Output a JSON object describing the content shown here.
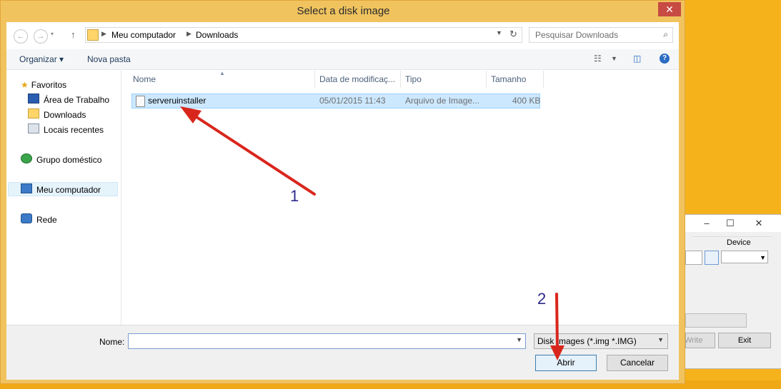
{
  "dialog": {
    "title": "Select a disk image",
    "close_label": "✕"
  },
  "address": {
    "back_glyph": "←",
    "forward_glyph": "→",
    "up_glyph": "↑",
    "crumbs": [
      "Meu computador",
      "Downloads"
    ],
    "search_placeholder": "Pesquisar Downloads"
  },
  "toolbar": {
    "organize_label": "Organizar ▾",
    "new_folder_label": "Nova pasta",
    "help_label": "?"
  },
  "nav": {
    "items": [
      {
        "label": "Favoritos",
        "icon": "star-icon"
      },
      {
        "label": "Área de Trabalho",
        "icon": "desktop-icon"
      },
      {
        "label": "Downloads",
        "icon": "folder-icon"
      },
      {
        "label": "Locais recentes",
        "icon": "recent-places-icon"
      },
      {
        "label": "Grupo doméstico",
        "icon": "homegroup-icon"
      },
      {
        "label": "Meu computador",
        "icon": "computer-icon",
        "selected": true
      },
      {
        "label": "Rede",
        "icon": "network-icon"
      }
    ]
  },
  "files": {
    "columns": [
      "Nome",
      "Data de modificaç...",
      "Tipo",
      "Tamanho"
    ],
    "rows": [
      {
        "name": "serveruinstaller",
        "date": "05/01/2015 11:43",
        "type": "Arquivo de Image...",
        "size": "400 KB",
        "selected": true
      }
    ]
  },
  "bottom": {
    "name_label": "Nome:",
    "name_value": "",
    "filter_value": "Disk Images (*.img *.IMG)",
    "open_label": "Abrir",
    "cancel_label": "Cancelar"
  },
  "background_window": {
    "device_label": "Device",
    "write_label": "Write",
    "exit_label": "Exit"
  },
  "annotations": {
    "step1": "1",
    "step2": "2",
    "arrow_color": "#d9261c"
  }
}
